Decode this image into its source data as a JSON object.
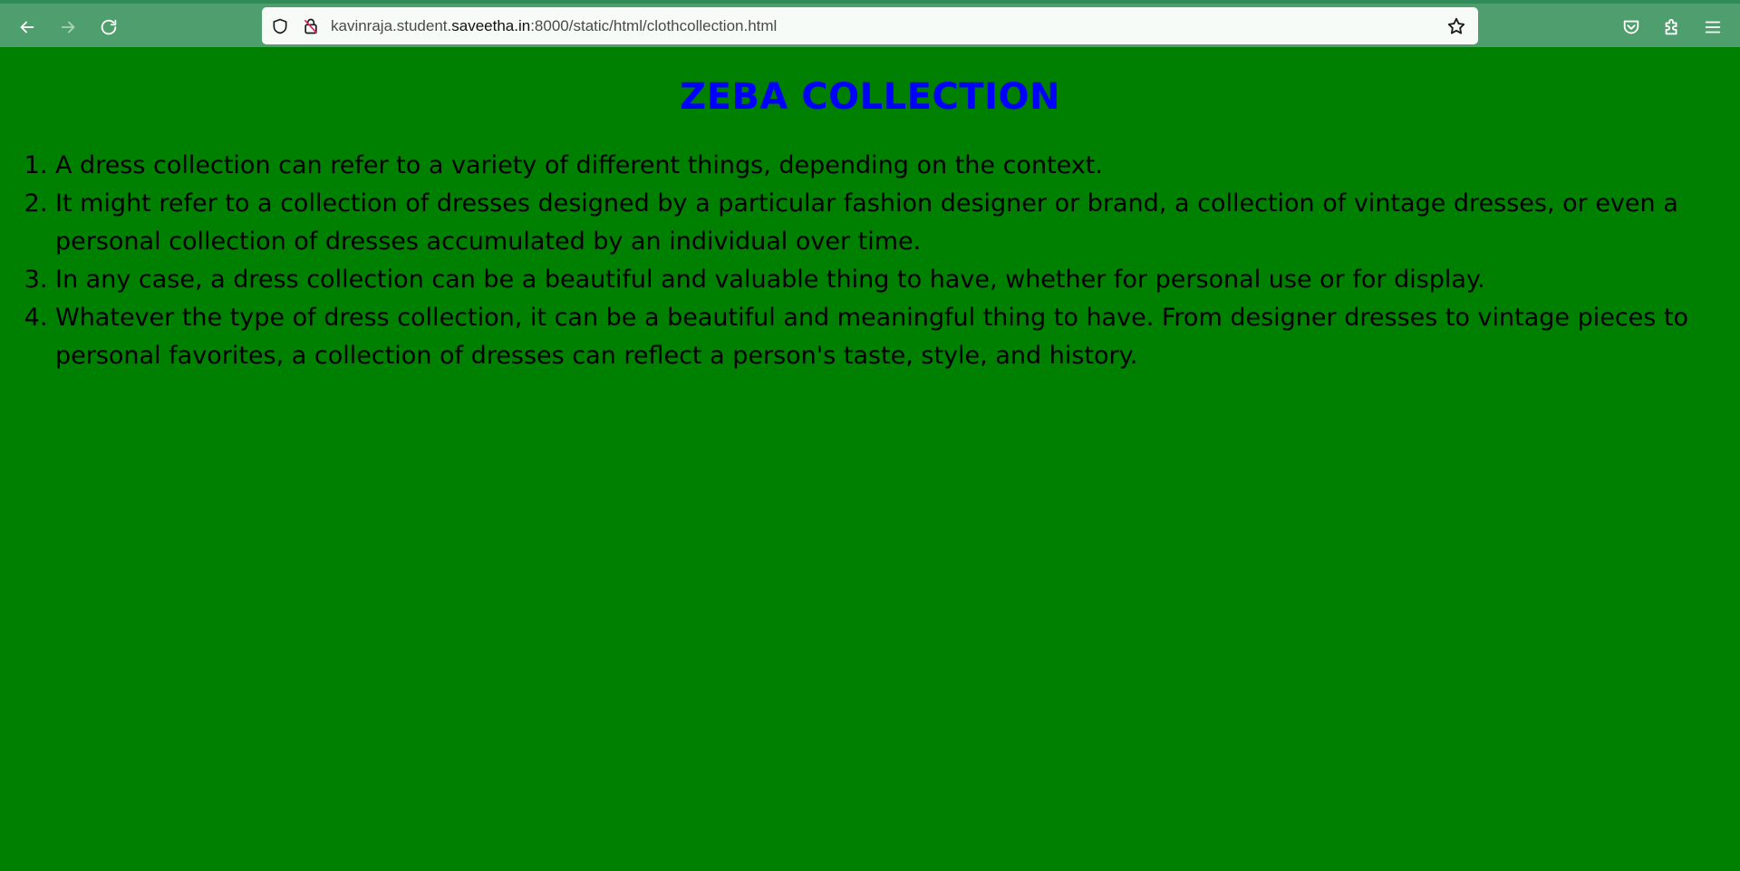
{
  "browser": {
    "url_prefix": "kavinraja.student.",
    "url_host": "saveetha.in",
    "url_suffix": ":8000/static/html/clothcollection.html",
    "icons": {
      "back": "back-arrow-icon",
      "forward": "forward-arrow-icon",
      "reload": "reload-icon",
      "shield": "shield-icon",
      "insecure": "insecure-lock-icon",
      "bookmark": "star-icon",
      "pocket": "pocket-icon",
      "extensions": "puzzle-icon",
      "menu": "hamburger-menu-icon"
    },
    "toolbar_color": "#4f9e6d"
  },
  "page": {
    "background": "#008000",
    "title": "ZEBA COLLECTION",
    "title_color": "#0000ff",
    "items": [
      "A dress collection can refer to a variety of different things, depending on the context.",
      "It might refer to a collection of dresses designed by a particular fashion designer or brand, a collection of vintage dresses, or even a personal collection of dresses accumulated by an individual over time.",
      "In any case, a dress collection can be a beautiful and valuable thing to have, whether for personal use or for display.",
      "Whatever the type of dress collection, it can be a beautiful and meaningful thing to have. From designer dresses to vintage pieces to personal favorites, a collection of dresses can reflect a person's taste, style, and history."
    ]
  }
}
